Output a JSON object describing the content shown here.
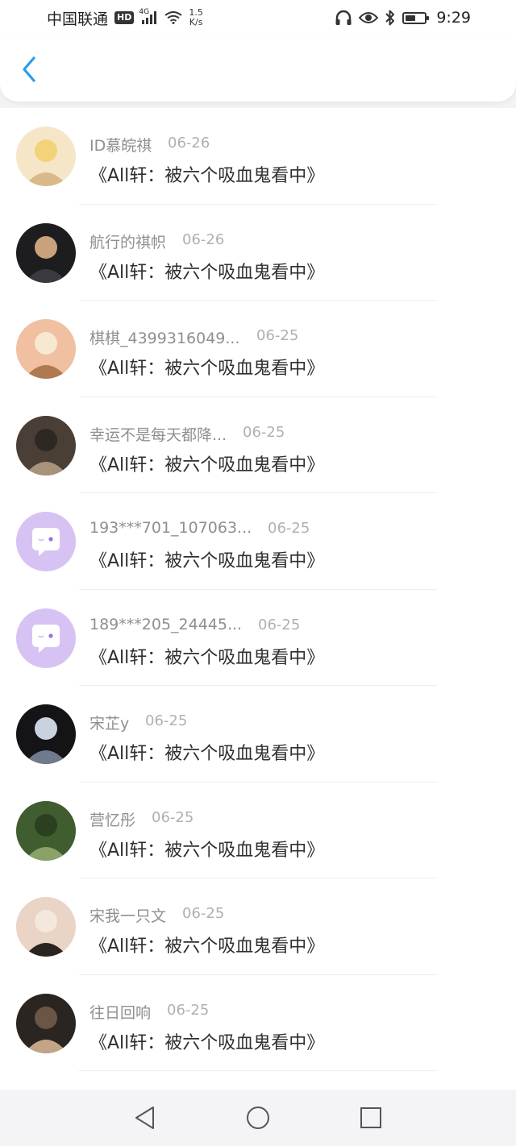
{
  "status_bar": {
    "carrier": "中国联通",
    "hd_badge": "HD",
    "network": "4G",
    "speed_value": "1.5",
    "speed_unit": "K/s",
    "time": "9:29"
  },
  "colors": {
    "accent": "#2b9bf0",
    "default_avatar_bg": "#d6c3f3"
  },
  "items": [
    {
      "username": "ID慕皖祺",
      "date": "06-26",
      "message": "《All轩：被六个吸血鬼看中》",
      "avatar": "photo"
    },
    {
      "username": "航行的祺帜",
      "date": "06-26",
      "message": "《All轩：被六个吸血鬼看中》",
      "avatar": "photo"
    },
    {
      "username": "棋棋_4399316049...",
      "date": "06-25",
      "message": "《All轩：被六个吸血鬼看中》",
      "avatar": "photo"
    },
    {
      "username": "幸运不是每天都降...",
      "date": "06-25",
      "message": "《All轩：被六个吸血鬼看中》",
      "avatar": "photo"
    },
    {
      "username": "193***701_107063...",
      "date": "06-25",
      "message": "《All轩：被六个吸血鬼看中》",
      "avatar": "default-chat-bubble"
    },
    {
      "username": "189***205_24445...",
      "date": "06-25",
      "message": "《All轩：被六个吸血鬼看中》",
      "avatar": "default-chat-bubble"
    },
    {
      "username": "宋芷y",
      "date": "06-25",
      "message": "《All轩：被六个吸血鬼看中》",
      "avatar": "photo"
    },
    {
      "username": "营忆彤",
      "date": "06-25",
      "message": "《All轩：被六个吸血鬼看中》",
      "avatar": "photo"
    },
    {
      "username": "宋我一只文",
      "date": "06-25",
      "message": "《All轩：被六个吸血鬼看中》",
      "avatar": "photo"
    },
    {
      "username": "往日回响",
      "date": "06-25",
      "message": "《All轩：被六个吸血鬼看中》",
      "avatar": "photo"
    }
  ]
}
